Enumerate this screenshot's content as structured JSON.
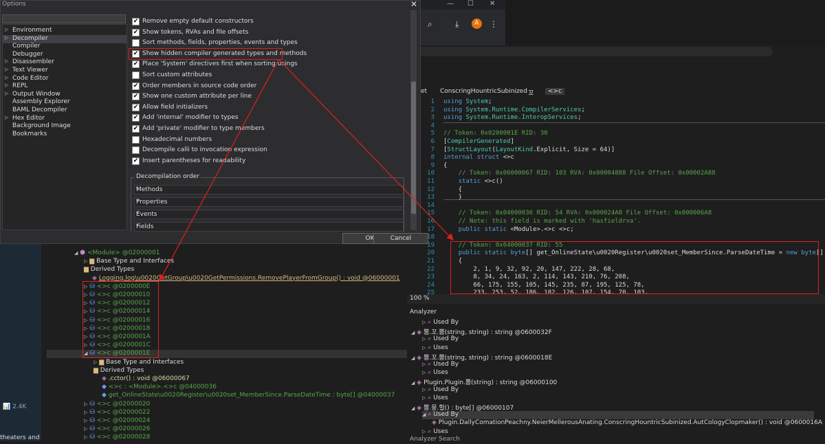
{
  "dialog": {
    "title": "Options",
    "categories": [
      "Environment",
      "Decompiler",
      "Compiler",
      "Debugger",
      "Disassembler",
      "Text Viewer",
      "Code Editor",
      "REPL",
      "Output Window",
      "Assembly Explorer",
      "BAML Decompiler",
      "Hex Editor",
      "Background Image",
      "Bookmarks"
    ],
    "options": [
      {
        "label": "Remove empty default constructors",
        "checked": true
      },
      {
        "label": "Show tokens, RVAs and file offsets",
        "checked": true
      },
      {
        "label": "Sort methods, fields, properties, events and types",
        "checked": false
      },
      {
        "label": "Show hidden compiler generated types and methods",
        "checked": true
      },
      {
        "label": "Place 'System' directives first when sorting usings",
        "checked": true
      },
      {
        "label": "Sort custom attributes",
        "checked": false
      },
      {
        "label": "Order members in source code order",
        "checked": true
      },
      {
        "label": "Show one custom attribute per line",
        "checked": true
      },
      {
        "label": "Allow field initializers",
        "checked": true
      },
      {
        "label": "Add 'internal' modifier to types",
        "checked": true
      },
      {
        "label": "Add 'private' modifier to type members",
        "checked": true
      },
      {
        "label": "Hexadecimal numbers",
        "checked": false
      },
      {
        "label": "Decompile calli to invocation expression",
        "checked": false
      },
      {
        "label": "Insert parentheses for readability",
        "checked": true
      }
    ],
    "order_legend": "Decompilation order",
    "order_items": [
      "Methods",
      "Properties",
      "Events",
      "Fields"
    ],
    "ok_label": "OK",
    "cancel_label": "Cancel"
  },
  "browser": {
    "min": "—",
    "max": "☐",
    "close": "✕",
    "avatar": "A"
  },
  "tabs": [
    "et",
    "ConscringHountricSubinized",
    "꼬",
    "<>c"
  ],
  "code_lines": [
    {
      "n": "1",
      "t": "using System;"
    },
    {
      "n": "2",
      "t": "using System.Runtime.CompilerServices;"
    },
    {
      "n": "3",
      "t": "using System.Runtime.InteropServices;"
    },
    {
      "n": "4",
      "t": ""
    },
    {
      "n": "5",
      "t": "// Token: 0x0200001E RID: 30"
    },
    {
      "n": "6",
      "t": "[CompilerGenerated]"
    },
    {
      "n": "7",
      "t": "[StructLayout(LayoutKind.Explicit, Size = 64)]"
    },
    {
      "n": "8",
      "t": "internal struct <>c"
    },
    {
      "n": "9",
      "t": "{"
    },
    {
      "n": "10",
      "t": "    // Token: 0x06000067 RID: 103 RVA: 0x00004888 File Offset: 0x00002A88"
    },
    {
      "n": "11",
      "t": "    static <>c()"
    },
    {
      "n": "12",
      "t": "    {"
    },
    {
      "n": "13",
      "t": "    }"
    },
    {
      "n": "14",
      "t": ""
    },
    {
      "n": "15",
      "t": "    // Token: 0x04000036 RID: 54 RVA: 0x000024A8 File Offset: 0x000006A8"
    },
    {
      "n": "16",
      "t": "    // Note: this field is marked with 'hasfieldrva'."
    },
    {
      "n": "17",
      "t": "    public static <Module>.<>c <>c;"
    },
    {
      "n": "18",
      "t": ""
    },
    {
      "n": "19",
      "t": "    // Token: 0x04000037 RID: 55"
    },
    {
      "n": "20",
      "t": "    public static byte[] get_OnlineState\\u0020Register\\u0020set_MemberSince.ParseDateTime = new byte[]"
    },
    {
      "n": "21",
      "t": "    {"
    },
    {
      "n": "22",
      "t": "        2, 1, 9, 32, 92, 20, 147, 222, 28, 68,"
    },
    {
      "n": "23",
      "t": "        8, 34, 24, 163, 2, 114, 143, 210, 76, 208,"
    },
    {
      "n": "24",
      "t": "        66, 175, 155, 105, 145, 235, 87, 195, 125, 78,"
    },
    {
      "n": "25",
      "t": "        233, 253, 52, 186, 182, 126, 107, 154, 70, 103,"
    }
  ],
  "zoom": "100 %",
  "analyzer": {
    "title": "Analyzer",
    "rows": [
      {
        "text": "Used By"
      },
      {
        "text": "뿜.꼬.뿜(string, string) : string @0600032F"
      },
      {
        "text": "Used By"
      },
      {
        "text": "Uses"
      },
      {
        "text": "뿜.꼬.뿜(string, string) : string @0600018E"
      },
      {
        "text": "Used By"
      },
      {
        "text": "Uses"
      },
      {
        "text": "Plugin.Plugin.뿜(string) : string @06000100"
      },
      {
        "text": "Used By"
      },
      {
        "text": "Uses"
      },
      {
        "text": "뿜.뭉.헐() : byte[] @06000107"
      },
      {
        "text": "Used By"
      },
      {
        "text": "Plugin.DallyComationPeachny.NeierMellerousAnating.ConscringHountricSubinized.AutCologyClopmaker() : void @0600016A"
      },
      {
        "text": "Uses"
      }
    ],
    "bottom_tabs": [
      "Analyzer",
      "Search"
    ]
  },
  "tree": {
    "module": "<Module> @02000001",
    "base_type": "Base Type and Interfaces",
    "derived": "Derived Types",
    "logging": "Logging.log\\u0020GetGroup\\u0020GetPermissions.RemovePlayerFromGroup() : void @06000001",
    "classes": [
      "<>c @0200000E",
      "<>c @02000010",
      "<>c @02000012",
      "<>c @02000014",
      "<>c @02000016",
      "<>c @02000018",
      "<>c @0200001A",
      "<>c @0200001C",
      "<>c @0200001E"
    ],
    "sub_base": "Base Type and Interfaces",
    "sub_derived": "Derived Types",
    "cctor": ".cctor() : void @06000067",
    "field_c": "<>c : <Module>.<>c @04000036",
    "field_get": "get_OnlineState\\u0020Register\\u0020set_MemberSince.ParseDateTime : byte[] @04000037",
    "more": [
      "<>c @02000020",
      "<>c @02000022",
      "<>c @02000024",
      "<>c @02000026",
      "<>c @02000028"
    ]
  },
  "left_bg": {
    "likes": "2.4K",
    "text": "theaters and"
  },
  "colors": {
    "accent": "#e02020",
    "keyword": "#569cd6",
    "comment": "#57a64a",
    "type": "#4ec9b0"
  }
}
